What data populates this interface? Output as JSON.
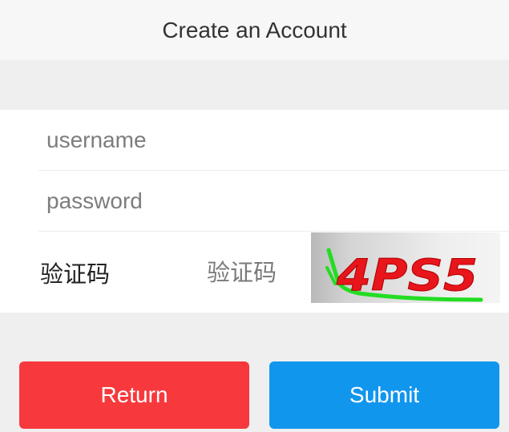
{
  "header": {
    "title": "Create an Account"
  },
  "form": {
    "username": {
      "placeholder": "username",
      "value": ""
    },
    "password": {
      "placeholder": "password",
      "value": ""
    },
    "captcha": {
      "label": "验证码",
      "placeholder": "验证码",
      "value": "",
      "image_text": "4PS5",
      "image_text_color": "#e8161c",
      "image_line_color": "#22dd22"
    }
  },
  "buttons": {
    "return_label": "Return",
    "return_color": "#f7393d",
    "submit_label": "Submit",
    "submit_color": "#1196ee"
  }
}
